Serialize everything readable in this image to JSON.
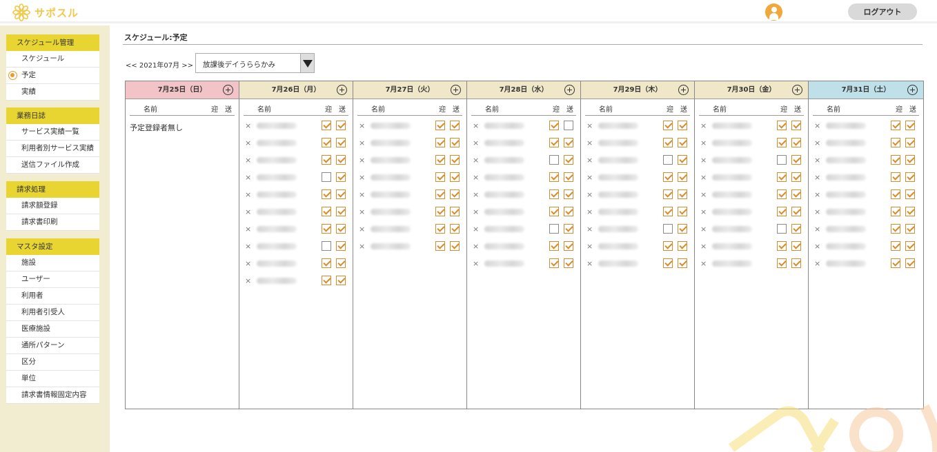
{
  "header": {
    "logo_text": "サポスル",
    "logout_label": "ログアウト"
  },
  "sidebar": {
    "groups": [
      {
        "title": "スケジュール管理",
        "items": [
          "スケジュール",
          "予定",
          "実績"
        ]
      },
      {
        "title": "業務日誌",
        "items": [
          "サービス実績一覧",
          "利用者別サービス実績",
          "送信ファイル作成"
        ]
      },
      {
        "title": "請求処理",
        "items": [
          "請求額登録",
          "請求書印刷"
        ]
      },
      {
        "title": "マスタ設定",
        "items": [
          "施設",
          "ユーザー",
          "利用者",
          "利用者引受人",
          "医療施設",
          "通所パターン",
          "区分",
          "単位",
          "請求書情報固定内容"
        ]
      }
    ],
    "active_item": "予定"
  },
  "page": {
    "title": "スケジュール:予定",
    "month_nav": "<< 2021年07月 >>",
    "facility": "放課後デイうららかみ"
  },
  "columns": {
    "name": "名前",
    "pickup": "迎",
    "dropoff": "送"
  },
  "days": [
    {
      "label": "7月25日（日）",
      "kind": "sun",
      "empty_message": "予定登録者無し",
      "rows": []
    },
    {
      "label": "7月26日（月）",
      "kind": "wk",
      "rows": [
        {
          "pickup": true,
          "dropoff": true
        },
        {
          "pickup": true,
          "dropoff": true
        },
        {
          "pickup": true,
          "dropoff": true
        },
        {
          "pickup": false,
          "dropoff": true
        },
        {
          "pickup": true,
          "dropoff": true
        },
        {
          "pickup": true,
          "dropoff": true
        },
        {
          "pickup": true,
          "dropoff": true
        },
        {
          "pickup": false,
          "dropoff": true
        },
        {
          "pickup": true,
          "dropoff": true
        },
        {
          "pickup": true,
          "dropoff": true
        }
      ]
    },
    {
      "label": "7月27日（火）",
      "kind": "wk",
      "rows": [
        {
          "pickup": true,
          "dropoff": true
        },
        {
          "pickup": true,
          "dropoff": true
        },
        {
          "pickup": true,
          "dropoff": true
        },
        {
          "pickup": true,
          "dropoff": true
        },
        {
          "pickup": true,
          "dropoff": true
        },
        {
          "pickup": true,
          "dropoff": true
        },
        {
          "pickup": true,
          "dropoff": true
        },
        {
          "pickup": true,
          "dropoff": true
        }
      ]
    },
    {
      "label": "7月28日（水）",
      "kind": "wk",
      "rows": [
        {
          "pickup": true,
          "dropoff": false
        },
        {
          "pickup": true,
          "dropoff": true
        },
        {
          "pickup": false,
          "dropoff": true
        },
        {
          "pickup": true,
          "dropoff": true
        },
        {
          "pickup": true,
          "dropoff": true
        },
        {
          "pickup": true,
          "dropoff": true
        },
        {
          "pickup": false,
          "dropoff": true
        },
        {
          "pickup": true,
          "dropoff": true
        },
        {
          "pickup": true,
          "dropoff": true
        }
      ]
    },
    {
      "label": "7月29日（木）",
      "kind": "wk",
      "rows": [
        {
          "pickup": true,
          "dropoff": true
        },
        {
          "pickup": true,
          "dropoff": true
        },
        {
          "pickup": false,
          "dropoff": true
        },
        {
          "pickup": true,
          "dropoff": true
        },
        {
          "pickup": true,
          "dropoff": true
        },
        {
          "pickup": true,
          "dropoff": true
        },
        {
          "pickup": false,
          "dropoff": true
        },
        {
          "pickup": true,
          "dropoff": true
        },
        {
          "pickup": true,
          "dropoff": true
        }
      ]
    },
    {
      "label": "7月30日（金）",
      "kind": "wk",
      "rows": [
        {
          "pickup": true,
          "dropoff": true
        },
        {
          "pickup": true,
          "dropoff": true
        },
        {
          "pickup": false,
          "dropoff": true
        },
        {
          "pickup": true,
          "dropoff": true
        },
        {
          "pickup": true,
          "dropoff": true
        },
        {
          "pickup": true,
          "dropoff": true
        },
        {
          "pickup": false,
          "dropoff": true
        },
        {
          "pickup": true,
          "dropoff": true
        },
        {
          "pickup": true,
          "dropoff": true
        }
      ]
    },
    {
      "label": "7月31日（土）",
      "kind": "sat",
      "rows": [
        {
          "pickup": true,
          "dropoff": true
        },
        {
          "pickup": true,
          "dropoff": true
        },
        {
          "pickup": true,
          "dropoff": true
        },
        {
          "pickup": true,
          "dropoff": true
        },
        {
          "pickup": true,
          "dropoff": true
        },
        {
          "pickup": true,
          "dropoff": true
        },
        {
          "pickup": true,
          "dropoff": true
        },
        {
          "pickup": true,
          "dropoff": true
        },
        {
          "pickup": true,
          "dropoff": true
        }
      ]
    }
  ],
  "icons": {
    "logo": "flower-logo-icon",
    "user": "user-avatar-icon",
    "add": "plus-circle-icon",
    "remove": "close-icon",
    "select": "chevron-down-icon"
  },
  "colors": {
    "accent": "#e8d531",
    "logo": "#f2c84b",
    "check": "#d98a2a",
    "sunday": "#f2c4c7",
    "weekday": "#efe7c8",
    "saturday": "#bfe0e8"
  }
}
